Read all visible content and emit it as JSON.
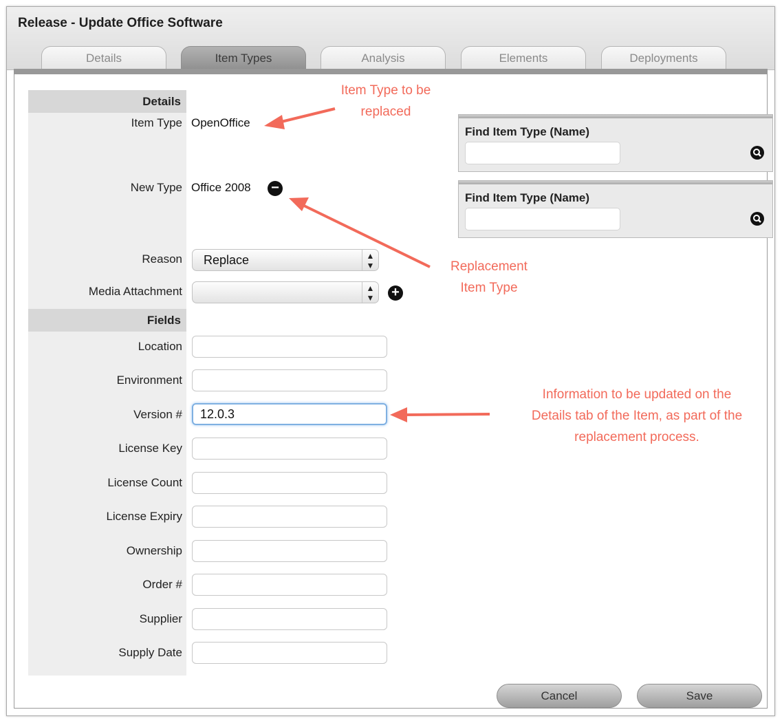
{
  "window": {
    "title": "Release - Update Office Software"
  },
  "tabs": [
    {
      "label": "Details",
      "active": false
    },
    {
      "label": "Item Types",
      "active": true
    },
    {
      "label": "Analysis",
      "active": false
    },
    {
      "label": "Elements",
      "active": false
    },
    {
      "label": "Deployments",
      "active": false
    }
  ],
  "details": {
    "heading": "Details",
    "item_type_label": "Item Type",
    "item_type_value": "OpenOffice",
    "new_type_label": "New Type",
    "new_type_value": "Office 2008",
    "reason_label": "Reason",
    "reason_value": "Replace",
    "media_label": "Media Attachment",
    "media_value": ""
  },
  "find_boxes": [
    {
      "label": "Find Item Type (Name)",
      "value": ""
    },
    {
      "label": "Find Item Type (Name)",
      "value": ""
    }
  ],
  "fields": {
    "heading": "Fields",
    "location_label": "Location",
    "location_value": "",
    "environment_label": "Environment",
    "environment_value": "",
    "version_label": "Version #",
    "version_value": "12.0.3",
    "license_key_label": "License Key",
    "license_key_value": "",
    "license_count_label": "License Count",
    "license_count_value": "",
    "license_expiry_label": "License Expiry",
    "license_expiry_value": "",
    "ownership_label": "Ownership",
    "ownership_value": "",
    "order_label": "Order #",
    "order_value": "",
    "supplier_label": "Supplier",
    "supplier_value": "",
    "supply_date_label": "Supply Date",
    "supply_date_value": ""
  },
  "annotations": {
    "item_type_line1": "Item Type to be",
    "item_type_line2": "replaced",
    "replacement_line1": "Replacement",
    "replacement_line2": "Item Type",
    "info_line1": "Information to be updated on the",
    "info_line2": "Details tab of the Item, as part of the",
    "info_line3": "replacement process."
  },
  "buttons": {
    "cancel": "Cancel",
    "save": "Save"
  },
  "icons": {
    "remove": "minus-circle-icon",
    "add": "plus-circle-icon",
    "search": "magnifier-icon"
  },
  "colors": {
    "annotation": "#f26a5a",
    "active_tab": "#9a9a9a",
    "focus": "#7fb0e2"
  }
}
